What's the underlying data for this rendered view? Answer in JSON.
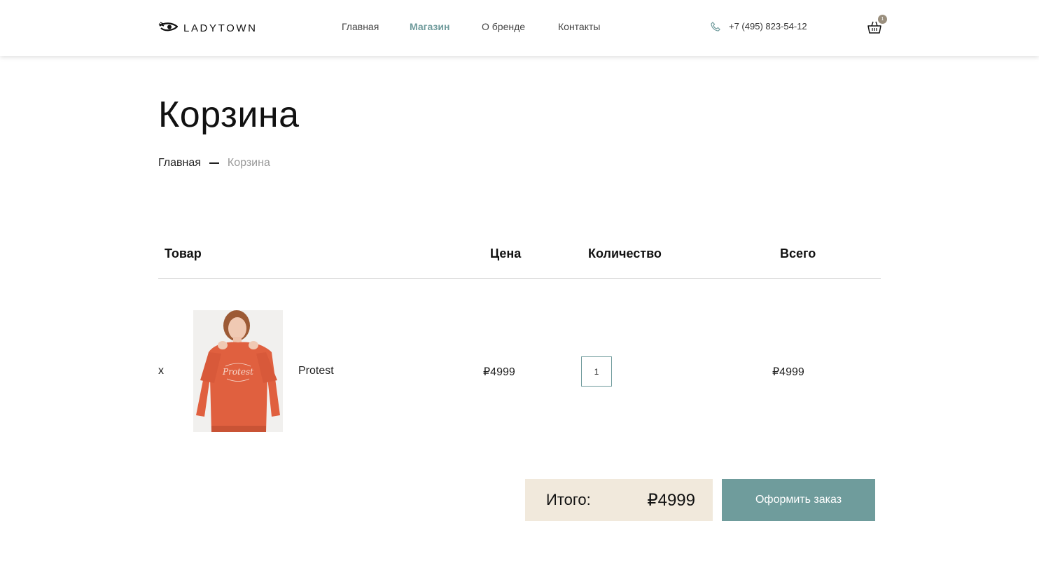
{
  "header": {
    "logo_text": "LADYTOWN",
    "nav": [
      {
        "label": "Главная"
      },
      {
        "label": "Магазин"
      },
      {
        "label": "О бренде"
      },
      {
        "label": "Контакты"
      }
    ],
    "phone": "+7 (495) 823-54-12",
    "cart_count": "1"
  },
  "page": {
    "title": "Корзина",
    "breadcrumb": {
      "home": "Главная",
      "current": "Корзина"
    }
  },
  "table": {
    "headers": {
      "product": "Товар",
      "price": "Цена",
      "quantity": "Количество",
      "total": "Всего"
    },
    "rows": [
      {
        "remove": "x",
        "name": "Protest",
        "price": "₽4999",
        "quantity": "1",
        "total": "₽4999"
      }
    ]
  },
  "summary": {
    "label": "Итого:",
    "value": "₽4999"
  },
  "checkout_label": "Оформить заказ",
  "colors": {
    "accent": "#6f9b9c",
    "summary_bg": "#f1e9dc",
    "badge": "#9a8f7e"
  }
}
